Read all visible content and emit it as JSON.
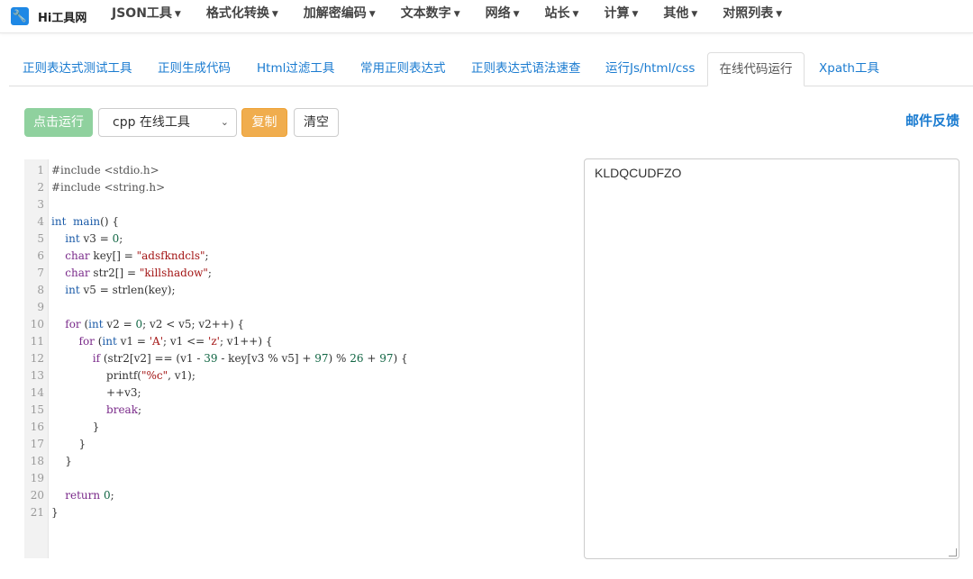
{
  "brand": {
    "name": "Hi工具网"
  },
  "nav": [
    {
      "label": "JSON工具"
    },
    {
      "label": "格式化转换"
    },
    {
      "label": "加解密编码"
    },
    {
      "label": "文本数字"
    },
    {
      "label": "网络"
    },
    {
      "label": "站长"
    },
    {
      "label": "计算"
    },
    {
      "label": "其他"
    },
    {
      "label": "对照列表"
    }
  ],
  "tabs": [
    {
      "label": "正则表达式测试工具"
    },
    {
      "label": "正则生成代码"
    },
    {
      "label": "Html过滤工具"
    },
    {
      "label": "常用正则表达式"
    },
    {
      "label": "正则表达式语法速查"
    },
    {
      "label": "运行Js/html/css"
    },
    {
      "label": "在线代码运行"
    },
    {
      "label": "Xpath工具"
    }
  ],
  "toolbar": {
    "run_label": "点击运行",
    "language_selected": "cpp 在线工具",
    "copy_label": "复制",
    "clear_label": "清空",
    "feedback_label": "邮件反馈"
  },
  "editor": {
    "line_numbers": [
      "1",
      "2",
      "3",
      "4",
      "5",
      "6",
      "7",
      "8",
      "9",
      "10",
      "11",
      "12",
      "13",
      "14",
      "15",
      "16",
      "17",
      "18",
      "19",
      "20",
      "21"
    ],
    "tokens": [
      [
        [
          "pp",
          "#include <stdio.h>"
        ]
      ],
      [
        [
          "pp",
          "#include <string.h>"
        ]
      ],
      [],
      [
        [
          "ty",
          "int"
        ],
        [
          "",
          "  "
        ],
        [
          "ty",
          "main"
        ],
        [
          "",
          "() {"
        ]
      ],
      [
        [
          "",
          "    "
        ],
        [
          "ty",
          "int"
        ],
        [
          "",
          " v3 = "
        ],
        [
          "nu",
          "0"
        ],
        [
          "",
          ";"
        ]
      ],
      [
        [
          "",
          "    "
        ],
        [
          "kw",
          "char"
        ],
        [
          "",
          " key[] = "
        ],
        [
          "st",
          "\"adsfkndcls\""
        ],
        [
          "",
          ";"
        ]
      ],
      [
        [
          "",
          "    "
        ],
        [
          "kw",
          "char"
        ],
        [
          "",
          " str2[] = "
        ],
        [
          "st",
          "\"killshadow\""
        ],
        [
          "",
          ";"
        ]
      ],
      [
        [
          "",
          "    "
        ],
        [
          "ty",
          "int"
        ],
        [
          "",
          " v5 = strlen(key);"
        ]
      ],
      [],
      [
        [
          "",
          "    "
        ],
        [
          "kw",
          "for"
        ],
        [
          "",
          " ("
        ],
        [
          "ty",
          "int"
        ],
        [
          "",
          " v2 = "
        ],
        [
          "nu",
          "0"
        ],
        [
          "",
          "; v2 < v5; v2++) {"
        ]
      ],
      [
        [
          "",
          "        "
        ],
        [
          "kw",
          "for"
        ],
        [
          "",
          " ("
        ],
        [
          "ty",
          "int"
        ],
        [
          "",
          " v1 = "
        ],
        [
          "st",
          "'A'"
        ],
        [
          "",
          "; v1 <= "
        ],
        [
          "st",
          "'z'"
        ],
        [
          "",
          "; v1++) {"
        ]
      ],
      [
        [
          "",
          "            "
        ],
        [
          "kw",
          "if"
        ],
        [
          "",
          " (str2[v2] == (v1 - "
        ],
        [
          "nu",
          "39"
        ],
        [
          "",
          " - key[v3 % v5] + "
        ],
        [
          "nu",
          "97"
        ],
        [
          "",
          ") % "
        ],
        [
          "nu",
          "26"
        ],
        [
          "",
          " + "
        ],
        [
          "nu",
          "97"
        ],
        [
          "",
          ") {"
        ]
      ],
      [
        [
          "",
          "                printf("
        ],
        [
          "st",
          "\"%c\""
        ],
        [
          "",
          ", v1);"
        ]
      ],
      [
        [
          "",
          "                ++v3;"
        ]
      ],
      [
        [
          "",
          "                "
        ],
        [
          "kw",
          "break"
        ],
        [
          "",
          ";"
        ]
      ],
      [
        [
          "",
          "            }"
        ]
      ],
      [
        [
          "",
          "        }"
        ]
      ],
      [
        [
          "",
          "    }"
        ]
      ],
      [],
      [
        [
          "",
          "    "
        ],
        [
          "kw",
          "return"
        ],
        [
          "",
          " "
        ],
        [
          "nu",
          "0"
        ],
        [
          "",
          ";"
        ]
      ],
      [
        [
          "",
          "}"
        ]
      ]
    ]
  },
  "output": {
    "text": "KLDQCUDFZO"
  }
}
